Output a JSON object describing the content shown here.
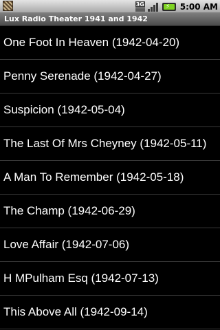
{
  "status_bar": {
    "notification_icon": "app-notification-icon",
    "network_type": "3G",
    "network_icon": "network-3g-icon",
    "signal_icon": "signal-strength-icon",
    "battery_icon": "battery-charging-icon",
    "time": "5:00 AM"
  },
  "title_bar": {
    "title": "Lux Radio Theater 1941 and 1942"
  },
  "episodes": [
    {
      "label": "One Foot In Heaven (1942-04-20)"
    },
    {
      "label": "Penny Serenade (1942-04-27)"
    },
    {
      "label": "Suspicion (1942-05-04)"
    },
    {
      "label": "The Last Of Mrs Cheyney (1942-05-11)"
    },
    {
      "label": "A Man To Remember (1942-05-18)"
    },
    {
      "label": "The Champ (1942-06-29)"
    },
    {
      "label": "Love Affair (1942-07-06)"
    },
    {
      "label": "H MPulham Esq (1942-07-13)"
    },
    {
      "label": "This Above All (1942-09-14)"
    }
  ],
  "colors": {
    "background": "#000000",
    "text": "#ffffff",
    "divider": "#3a3a3a",
    "battery": "#7ed321"
  }
}
